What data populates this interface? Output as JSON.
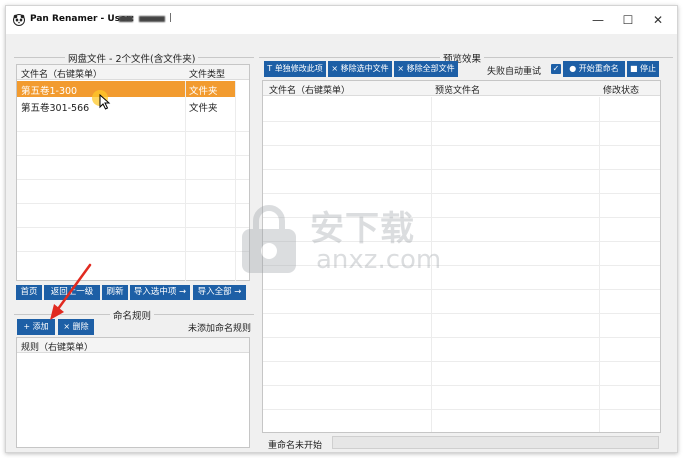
{
  "window": {
    "title": "Pan Renamer - User:",
    "title_sep": "|",
    "controls": {
      "minimize": "—",
      "maximize": "☐",
      "close": "✕"
    }
  },
  "left_panel": {
    "group_title": "网盘文件 - 2个文件(含文件夹)",
    "columns": [
      "文件名（右键菜单）",
      "文件类型"
    ],
    "rows": [
      {
        "name": "第五卷1-300",
        "type": "文件夹",
        "selected": true
      },
      {
        "name": "第五卷301-566",
        "type": "文件夹",
        "selected": false
      }
    ],
    "nav_buttons": [
      "首页",
      "返回上一级",
      "刷新",
      "导入选中项 →",
      "导入全部 →"
    ]
  },
  "rules_panel": {
    "group_title": "命名规则",
    "add_label": "+ 添加",
    "delete_label": "× 删除",
    "status": "未添加命名规则",
    "column": "规则（右键菜单）"
  },
  "preview_panel": {
    "group_title": "预览效果",
    "toolbar": {
      "edit_label": "T 单独修改此项",
      "remove_selected_label": "× 移除选中文件",
      "remove_all_label": "× 移除全部文件",
      "auto_retry_label": "失败自动重试",
      "auto_retry_checked": true,
      "start_label": "● 开始重命名",
      "stop_label": "■ 停止"
    },
    "columns": [
      "文件名（右键菜单）",
      "预览文件名",
      "修改状态"
    ],
    "status_text": "重命名未开始",
    "progress": 0
  },
  "watermark": {
    "text_cn": "安下载",
    "text_en": "anxz.com"
  },
  "colors": {
    "accent_blue": "#1d5fa6",
    "selection_orange": "#f29b2f",
    "progress_blue": "#0c7ad6"
  }
}
